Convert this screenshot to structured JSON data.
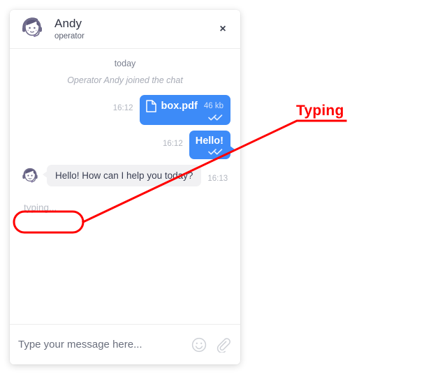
{
  "widget": {
    "header": {
      "avatar_icon": "operator-headset-avatar",
      "name": "Andy",
      "role": "operator",
      "close_icon": "close-icon",
      "close_label": "×"
    },
    "conversation": {
      "day_divider": "today",
      "system_message": "Operator Andy joined the chat",
      "messages": [
        {
          "id": "msg-file",
          "direction": "outgoing",
          "type": "file",
          "time": "16:12",
          "file_name": "box.pdf",
          "file_size": "46 kb",
          "status_icon": "double-check-icon",
          "has_tail": false
        },
        {
          "id": "msg-hello",
          "direction": "outgoing",
          "type": "text",
          "time": "16:12",
          "text": "Hello!",
          "status_icon": "double-check-icon",
          "has_tail": true
        },
        {
          "id": "msg-operator-greeting",
          "direction": "incoming",
          "type": "text",
          "time": "16:13",
          "text": "Hello! How can I help you today?",
          "avatar_icon": "operator-headset-avatar-small"
        }
      ],
      "typing_indicator": "typing..."
    },
    "composer": {
      "input_value": "",
      "input_placeholder": "Type your message here...",
      "emoji_icon": "smiley-face-icon",
      "attach_icon": "paperclip-icon"
    }
  },
  "annotation": {
    "label": "Typing",
    "color": "#ff0000"
  },
  "colors": {
    "outgoing_bubble": "#3d8bf8",
    "incoming_bubble": "#f1f1f3",
    "annotation_red": "#ff0000",
    "timestamp_gray": "#b3b7c0",
    "avatar_purple": "#6e6a8a"
  }
}
